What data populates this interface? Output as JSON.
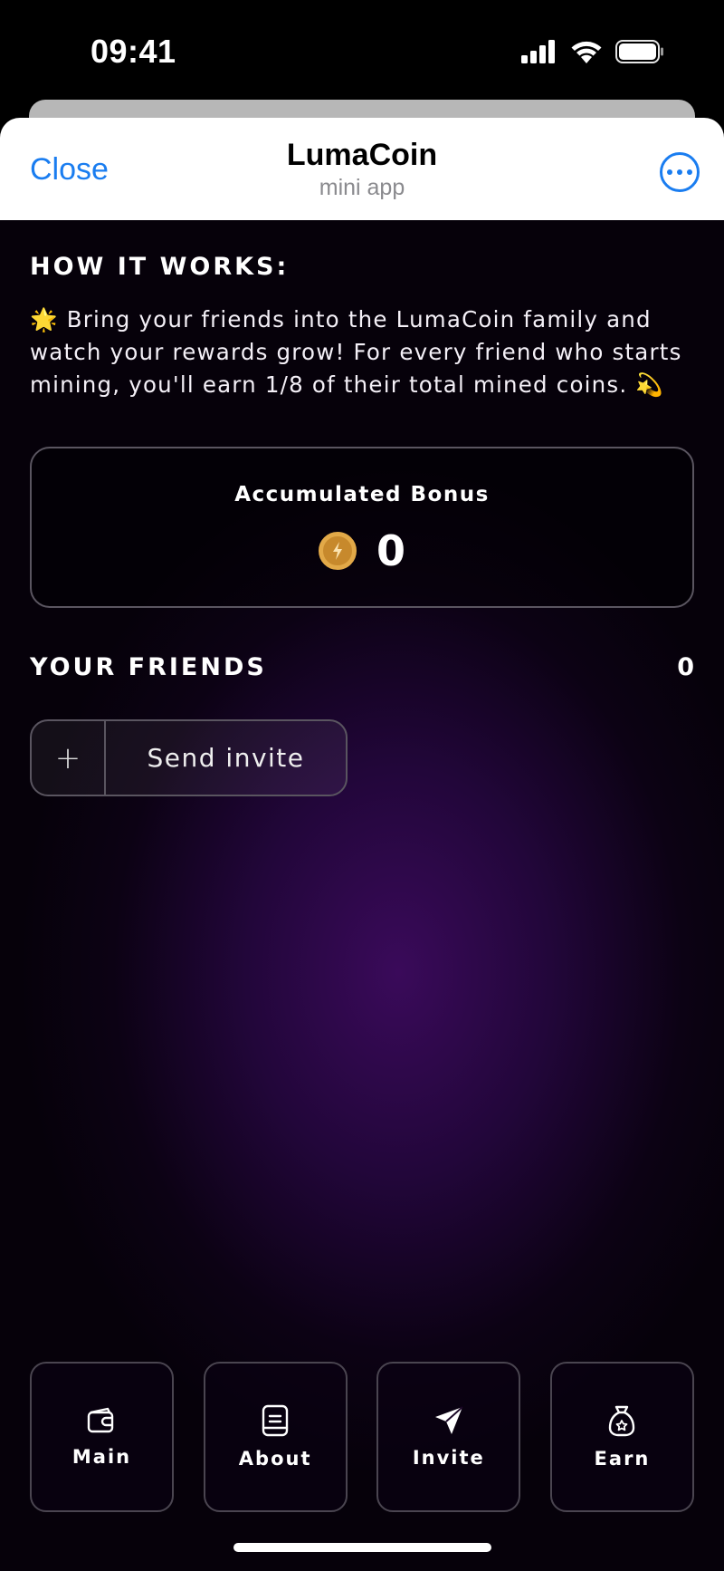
{
  "status_bar": {
    "time": "09:41"
  },
  "header": {
    "close_label": "Close",
    "title": "LumaCoin",
    "subtitle": "mini app"
  },
  "how_it_works": {
    "title": "HOW IT WORKS:",
    "text": "🌟 Bring your friends into the LumaCoin family and watch your rewards grow! For every friend who starts mining, you'll earn 1/8 of their total mined coins. 💫"
  },
  "bonus": {
    "label": "Accumulated Bonus",
    "value": "0"
  },
  "friends": {
    "title": "YOUR FRIENDS",
    "count": "0"
  },
  "invite": {
    "plus": "+",
    "label": "Send invite"
  },
  "nav": [
    {
      "label": "Main",
      "icon": "wallet-icon"
    },
    {
      "label": "About",
      "icon": "document-icon"
    },
    {
      "label": "Invite",
      "icon": "paper-plane-icon"
    },
    {
      "label": "Earn",
      "icon": "reward-bag-icon"
    }
  ],
  "colors": {
    "accent_blue": "#1a7df0",
    "coin_gold": "#c7892c",
    "bg_purple": "#3a0a5a"
  }
}
